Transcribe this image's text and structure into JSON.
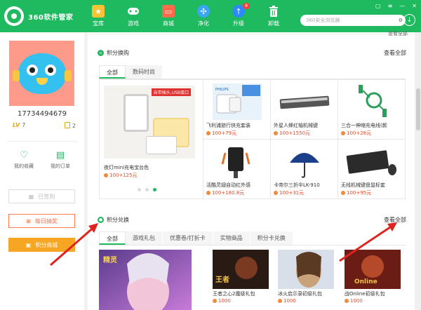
{
  "app": {
    "title": "360软件管家",
    "subtitle": ""
  },
  "nav": [
    {
      "label": "宝库",
      "icon": "star-icon",
      "color": "#f7c233"
    },
    {
      "label": "游戏",
      "icon": "gamepad-icon",
      "color": "#ffffff"
    },
    {
      "label": "商城",
      "icon": "bag-icon",
      "color": "#ff6b4a"
    },
    {
      "label": "净化",
      "icon": "fan-icon",
      "color": "#3aa6f7"
    },
    {
      "label": "升级",
      "icon": "upgrade-icon",
      "color": "#2e89ff",
      "badge": "8"
    },
    {
      "label": "卸载",
      "icon": "trash-icon",
      "color": "#ffffff"
    }
  ],
  "browser": {
    "placeholder": "360安全浏览器"
  },
  "user": {
    "phone": "17734494679",
    "level": "LV",
    "level_value": "7",
    "coins": "2"
  },
  "quick_links": [
    {
      "label": "我的收藏",
      "icon": "heart-icon"
    },
    {
      "label": "我的订单",
      "icon": "document-icon"
    }
  ],
  "side_buttons": {
    "signin": "已签到",
    "lottery": "每日抽奖",
    "mall": "积分商城"
  },
  "top_more": "查看全部",
  "points_buy": {
    "title": "积分换购",
    "more": "查看全部",
    "tabs": [
      "全部",
      "数码时尚"
    ],
    "feature": {
      "tag": "自带插头,USB接口",
      "name": "夜灯mini充电宝台色",
      "price": "100+125元"
    },
    "items": [
      {
        "name": "飞利浦旅行快充套装",
        "price": "100+79元"
      },
      {
        "name": "外星人蜂红轴机械键",
        "price": "100+1550元"
      },
      {
        "name": "三合一伸缩充电线(颜",
        "price": "100+28元"
      },
      {
        "name": "活酷灵翅自动红外感",
        "price": "100+180.8元"
      },
      {
        "name": "卡帝尔三折伞LK-910",
        "price": "100+31元"
      },
      {
        "name": "无线机械键盘鼠标套",
        "price": "100+95元"
      }
    ]
  },
  "points_redeem": {
    "title": "积分兑换",
    "more": "查看全部",
    "tabs": [
      "全部",
      "游戏礼包",
      "优惠卷/打折卡",
      "实物商品",
      "积分卡兑换"
    ],
    "games": [
      {
        "name": "",
        "price": ""
      },
      {
        "name": "王者之心2魔级礼包",
        "price": "1000"
      },
      {
        "name": "冰火启示录初级礼包",
        "price": "1000"
      },
      {
        "name": "战Online初级礼包",
        "price": "1000"
      }
    ]
  }
}
